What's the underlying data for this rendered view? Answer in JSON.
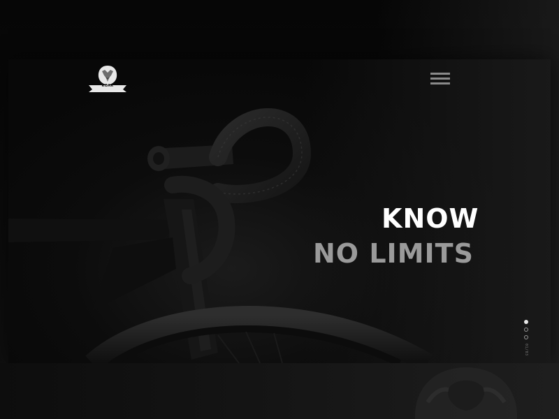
{
  "brand": {
    "name": "ROAR",
    "logo_icon": "lion-head-icon"
  },
  "header": {
    "menu_icon": "hamburger-menu-icon"
  },
  "hero": {
    "headline_line1": "KNOW",
    "headline_line2": "NO LIMITS",
    "image": "bicycle-handlebar-photo"
  },
  "slider": {
    "total_slides": 3,
    "active_index": 0,
    "label": "01/03"
  },
  "colors": {
    "background": "#050505",
    "headline_primary": "#ffffff",
    "headline_secondary": "#9a9a9a",
    "menu_icon": "#8a8a8a"
  }
}
